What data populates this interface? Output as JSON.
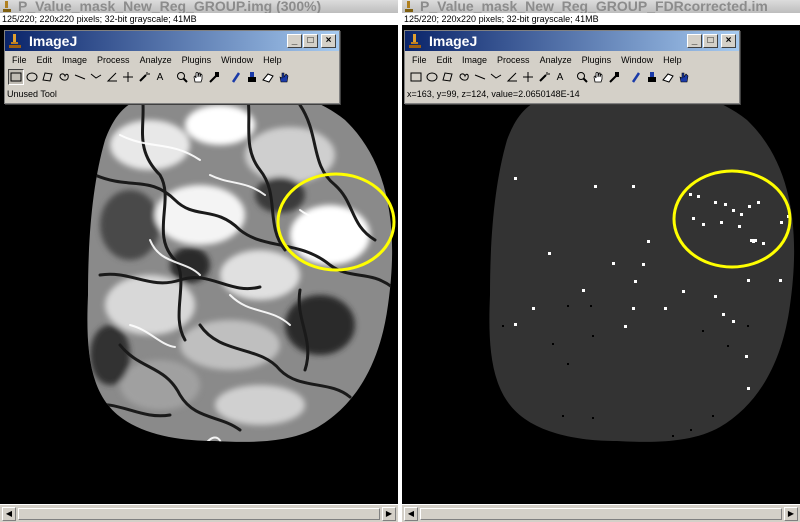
{
  "left_window": {
    "title": "P_Value_mask_New_Reg_GROUP.img (300%)",
    "info": "125/220; 220x220 pixels; 32-bit grayscale; 41MB"
  },
  "right_window": {
    "title": "P_Value_mask_New_Reg_GROUP_FDRcorrected.im",
    "info": "125/220; 220x220 pixels; 32-bit grayscale; 41MB"
  },
  "imagej_left": {
    "title": "ImageJ",
    "status": "Unused Tool"
  },
  "imagej_right": {
    "title": "ImageJ",
    "status": "x=163, y=99, z=124, value=2.0650148E-14"
  },
  "menu": {
    "file": "File",
    "edit": "Edit",
    "image": "Image",
    "process": "Process",
    "analyze": "Analyze",
    "plugins": "Plugins",
    "window": "Window",
    "help": "Help"
  },
  "window_buttons": {
    "minimize": "_",
    "maximize": "□",
    "close": "×"
  },
  "scroll_arrows": {
    "left": "◀",
    "right": "▶"
  },
  "tools": [
    "rectangle-tool",
    "oval-tool",
    "polygon-tool",
    "freehand-tool",
    "straight-line-tool",
    "segmented-line-tool",
    "angle-tool",
    "point-tool",
    "wand-tool",
    "text-tool",
    "magnifier-tool",
    "hand-tool",
    "color-picker-tool",
    "pencil-tool",
    "brush-tool",
    "eraser-tool",
    "dropper-tool"
  ],
  "colors": {
    "highlight_circle": "#ffff00",
    "brain_mask": "#333333",
    "ij_title_bar": "#0a246a"
  }
}
